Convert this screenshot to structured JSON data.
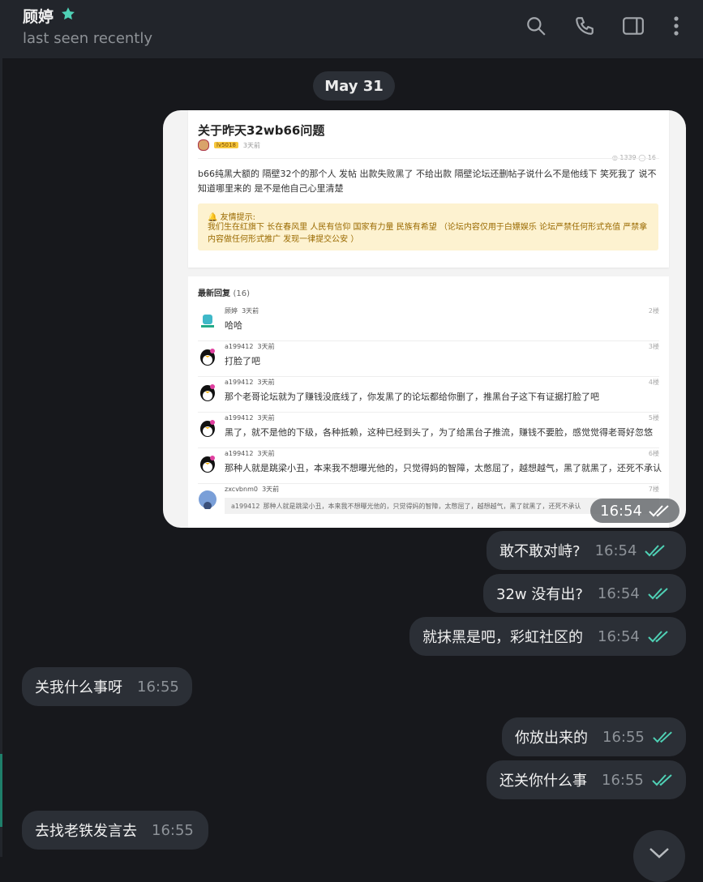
{
  "header": {
    "contact_name": "顾婷",
    "status": "last seen recently",
    "icons": [
      "search-icon",
      "phone-icon",
      "sidebar-toggle-icon",
      "more-vertical-icon"
    ]
  },
  "date_separator": "May 31",
  "image_message": {
    "time": "16:54",
    "screenshot": {
      "title": "关于昨天32wb66问题",
      "level_badge": "lv5018",
      "posted": "3天前",
      "stats": "◎ 1339  ◯ 16",
      "body": "b66纯黑大额的 隔壁32个的那个人 发帖 出款失败黑了 不给出款 隔壁论坛还删帖子说什么不是他线下 笑死我了 说不知道哪里来的 是不是他自己心里清楚",
      "notice_title": "🔔 友情提示:",
      "notice_text": "我们生在红旗下 长在春风里 人民有信仰 国家有力量 民族有希望 （论坛内容仅用于白嫖娱乐 论坛严禁任何形式充值 严禁拿内容做任何形式推广 发现一律提交公安 ）",
      "replies_label": "最新回复",
      "replies_count": "(16)",
      "replies": [
        {
          "user": "顾婷",
          "time": "3天前",
          "floor": "2楼",
          "text": "哈哈"
        },
        {
          "user": "a199412",
          "time": "3天前",
          "floor": "3楼",
          "text": "打脸了吧"
        },
        {
          "user": "a199412",
          "time": "3天前",
          "floor": "4楼",
          "text": "那个老哥论坛就为了赚钱没底线了，你发黑了的论坛都给你删了，推黑台子这下有证据打脸了吧"
        },
        {
          "user": "a199412",
          "time": "3天前",
          "floor": "5楼",
          "text": "黑了，就不是他的下级，各种抵赖，这种已经到头了，为了给黑台子推流，赚钱不要脸，感觉觉得老哥好忽悠"
        },
        {
          "user": "a199412",
          "time": "3天前",
          "floor": "6楼",
          "text": "那种人就是跳梁小丑，本来我不想曝光他的，只觉得妈的智障，太憋屈了，越想越气，黑了就黑了，还死不承认"
        },
        {
          "user": "zxcvbnm0",
          "time": "3天前",
          "floor": "7楼",
          "quote_user": "a199412",
          "quote_text": "那种人就是跳梁小丑，本来我不想曝光他的，只觉得妈的智障，太憋屈了，越想越气，黑了就黑了，还死不承认"
        }
      ]
    }
  },
  "messages": [
    {
      "text": "敢不敢对峙?",
      "time": "16:54",
      "outgoing": true
    },
    {
      "text": "32w 没有出?",
      "time": "16:54",
      "outgoing": true
    },
    {
      "text": "就抹黑是吧，彩虹社区的",
      "time": "16:54",
      "outgoing": true
    },
    {
      "text": "关我什么事呀",
      "time": "16:55",
      "outgoing": false
    },
    {
      "text": "你放出来的",
      "time": "16:55",
      "outgoing": true
    },
    {
      "text": "还关你什么事",
      "time": "16:55",
      "outgoing": true
    },
    {
      "text": "去找老铁发言去",
      "time": "16:55",
      "outgoing": false
    }
  ],
  "colors": {
    "accent": "#4fd1b5",
    "bubble": "#2b2f36",
    "background": "#17181c"
  }
}
